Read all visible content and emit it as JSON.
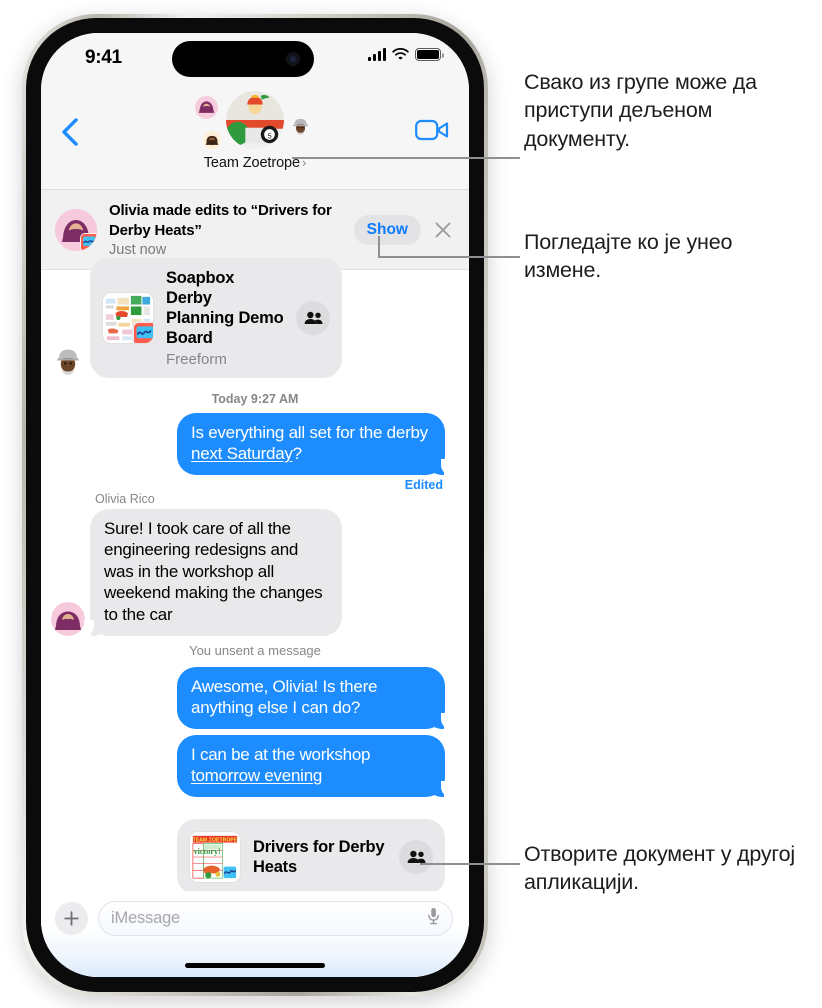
{
  "status_bar": {
    "time": "9:41",
    "signal_icon": "cellular-signal-icon",
    "wifi_icon": "wifi-icon",
    "battery_icon": "battery-icon"
  },
  "nav": {
    "back_icon": "back-chevron-icon",
    "video_icon": "facetime-video-icon",
    "group_title": "Team Zoetrope",
    "group_chevron": "›",
    "avatar_main": "group-photo-avatar",
    "avatar_small_1": "member-avatar-olivia",
    "avatar_small_2": "member-avatar-child",
    "avatar_small_3": "member-avatar-grandpa"
  },
  "notification": {
    "title": "Olivia made edits to “Drivers for Derby Heats”",
    "time": "Just now",
    "show_label": "Show",
    "close_icon": "close-x-icon",
    "avatar": "olivia-avatar",
    "app_badge": "freeform-app-badge"
  },
  "conversation": {
    "attachment_top": {
      "title": "Soapbox Derby Planning Demo Board",
      "subtitle": "Freeform",
      "thumb": "freeform-board-thumbnail",
      "app_icon": "freeform-app-icon",
      "people_icon": "participants-icon",
      "sender_avatar": "grandpa-memoji-avatar"
    },
    "timestamp": "Today 9:27 AM",
    "messages": [
      {
        "side": "out",
        "text_plain": "Is everything all set for the derby ",
        "text_link": "next Saturday",
        "text_tail": "?",
        "edited_label": "Edited"
      },
      {
        "side": "in",
        "sender": "Olivia Rico",
        "text_plain": "Sure! I took care of all the engineering redesigns and was in the workshop all weekend making the changes to the car",
        "avatar": "olivia-memoji-avatar"
      }
    ],
    "system_note": "You unsent a message",
    "messages_2": [
      {
        "side": "out",
        "text_plain": "Awesome, Olivia! Is there anything else I can do?"
      },
      {
        "side": "out",
        "text_plain": "I can be at the workshop ",
        "text_link": "tomorrow evening"
      }
    ],
    "attachment_bottom": {
      "title": "Drivers for Derby Heats",
      "thumb": "derby-heats-document-thumbnail",
      "people_icon": "participants-icon"
    }
  },
  "input_bar": {
    "plus_icon": "plus-icon",
    "placeholder": "iMessage",
    "mic_icon": "microphone-icon"
  },
  "annotations": [
    "Свако из групе може да приступи дељеном документу.",
    "Погледајте ко је унео измене.",
    "Отворите документ у другој апликацији."
  ],
  "colors": {
    "imessage_blue": "#1c8cff",
    "bubble_gray": "#e9e9eb",
    "accent_link": "#0b7bff",
    "annotation_line": "#8e8e93"
  }
}
